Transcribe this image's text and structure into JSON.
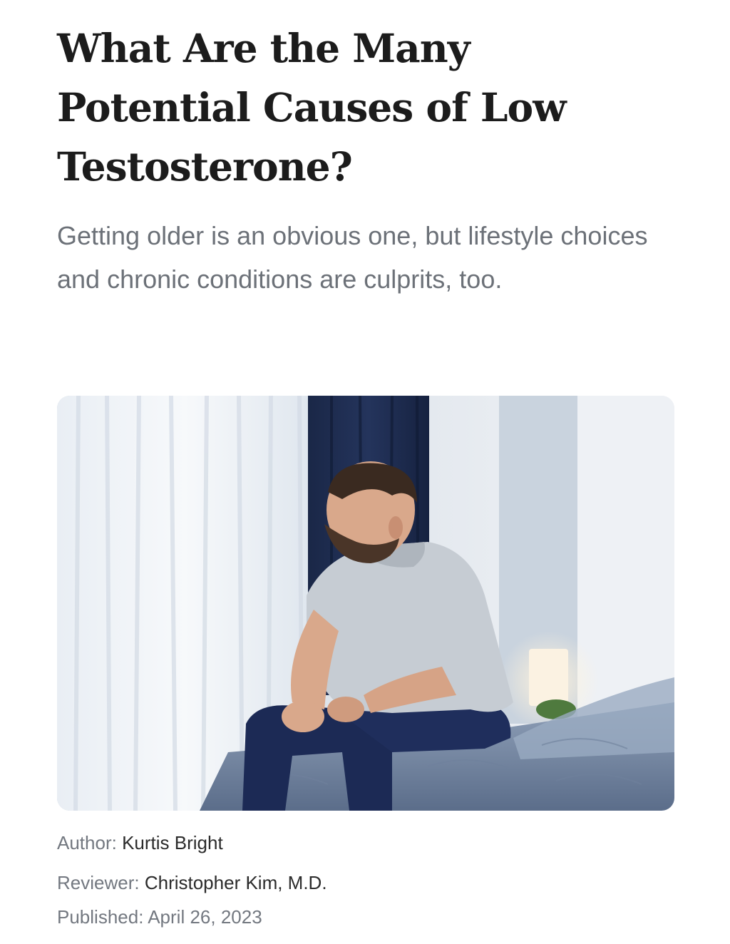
{
  "article": {
    "title": "What Are the Many Potential Causes of Low Testosterone?",
    "subtitle": "Getting older is an obvious one, but lifestyle choices and chronic conditions are culprits, too.",
    "image": {
      "subject": "man sitting on edge of bed looking out window"
    },
    "meta": {
      "author_label": "Author:",
      "author": "Kurtis Bright",
      "reviewer_label": "Reviewer:",
      "reviewer": "Christopher Kim, M.D.",
      "published_label": "Published:",
      "published": "April 26, 2023"
    }
  },
  "colors": {
    "title": "#1c1c1c",
    "subtitle": "#6c7178",
    "meta_label": "#737880",
    "meta_value": "#2b2b2b"
  }
}
